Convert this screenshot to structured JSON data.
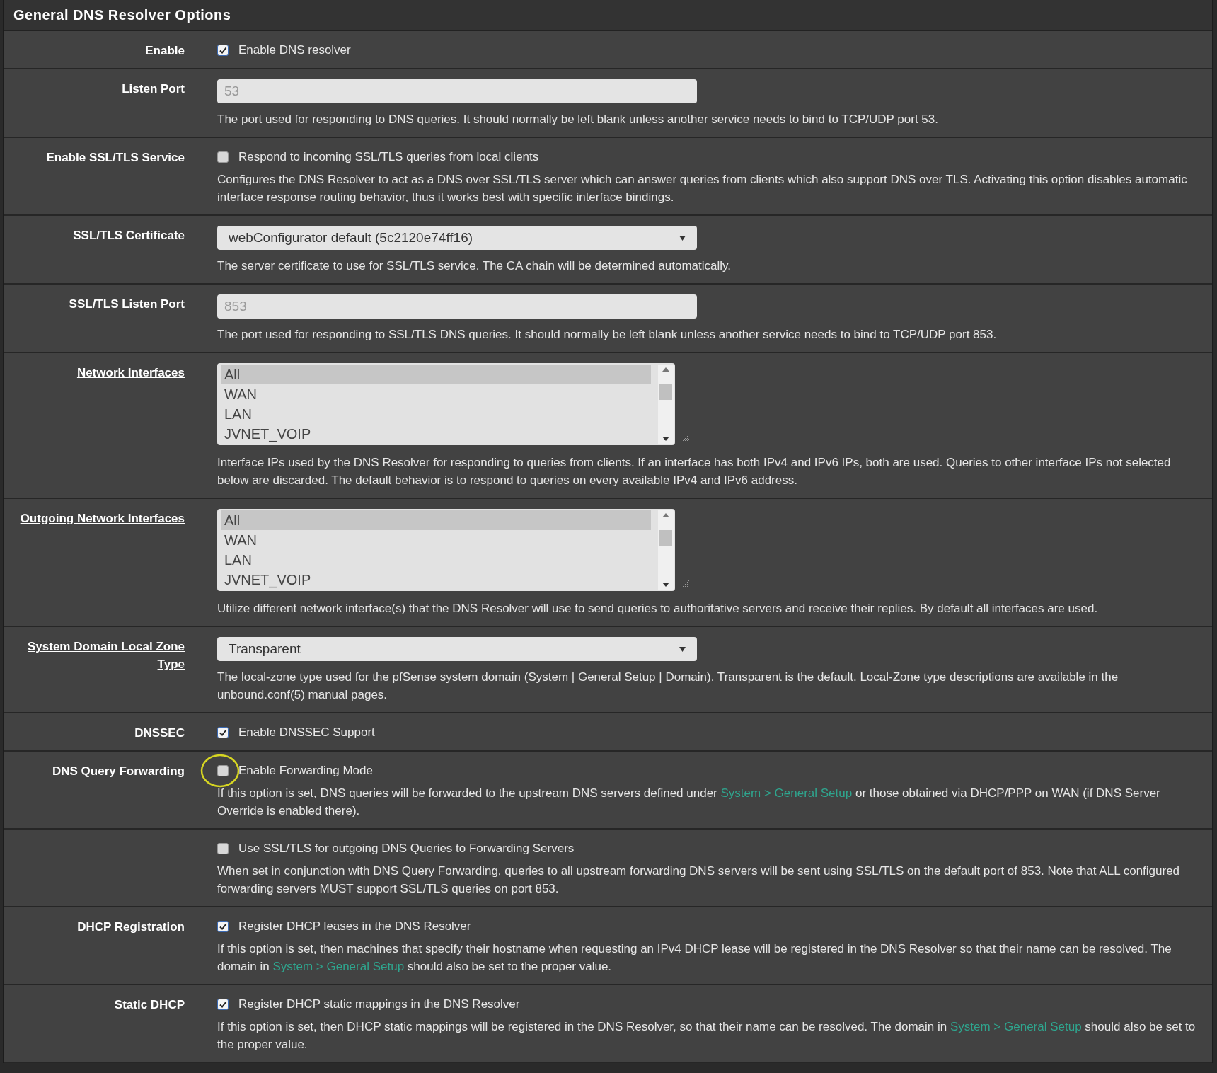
{
  "panel": {
    "title": "General DNS Resolver Options"
  },
  "rows": [
    {
      "label": "Enable",
      "label_link": false,
      "kind": "checkbox",
      "checked": true,
      "option": "Enable DNS resolver"
    },
    {
      "label": "Listen Port",
      "label_link": false,
      "kind": "input",
      "placeholder": "53",
      "description": [
        {
          "text": "The port used for responding to DNS queries. It should normally be left blank unless another service needs to bind to TCP/UDP port 53."
        }
      ]
    },
    {
      "label": "Enable SSL/TLS Service",
      "label_link": false,
      "kind": "checkbox",
      "checked": false,
      "option": "Respond to incoming SSL/TLS queries from local clients",
      "description": [
        {
          "text": "Configures the DNS Resolver to act as a DNS over SSL/TLS server which can answer queries from clients which also support DNS over TLS. Activating this option disables automatic interface response routing behavior, thus it works best with specific interface bindings."
        }
      ]
    },
    {
      "label": "SSL/TLS Certificate",
      "label_link": false,
      "kind": "select",
      "value": "webConfigurator default (5c2120e74ff16)",
      "description": [
        {
          "text": "The server certificate to use for SSL/TLS service. The CA chain will be determined automatically."
        }
      ]
    },
    {
      "label": "SSL/TLS Listen Port",
      "label_link": false,
      "kind": "input",
      "placeholder": "853",
      "description": [
        {
          "text": "The port used for responding to SSL/TLS DNS queries. It should normally be left blank unless another service needs to bind to TCP/UDP port 853."
        }
      ]
    },
    {
      "label": "Network Interfaces",
      "label_link": true,
      "kind": "listbox",
      "options": [
        {
          "label": "All",
          "selected": true
        },
        {
          "label": "WAN",
          "selected": false
        },
        {
          "label": "LAN",
          "selected": false
        },
        {
          "label": "JVNET_VOIP",
          "selected": false
        }
      ],
      "description": [
        {
          "text": "Interface IPs used by the DNS Resolver for responding to queries from clients. If an interface has both IPv4 and IPv6 IPs, both are used. Queries to other interface IPs not selected below are discarded. The default behavior is to respond to queries on every available IPv4 and IPv6 address."
        }
      ]
    },
    {
      "label": "Outgoing Network Interfaces",
      "label_link": true,
      "kind": "listbox",
      "options": [
        {
          "label": "All",
          "selected": true
        },
        {
          "label": "WAN",
          "selected": false
        },
        {
          "label": "LAN",
          "selected": false
        },
        {
          "label": "JVNET_VOIP",
          "selected": false
        }
      ],
      "description": [
        {
          "text": "Utilize different network interface(s) that the DNS Resolver will use to send queries to authoritative servers and receive their replies. By default all interfaces are used."
        }
      ]
    },
    {
      "label": "System Domain Local Zone Type",
      "label_link": true,
      "kind": "select",
      "value": "Transparent",
      "description": [
        {
          "text": "The local-zone type used for the pfSense system domain (System | General Setup | Domain). Transparent is the default. Local-Zone type descriptions are available in the unbound.conf(5) manual pages."
        }
      ]
    },
    {
      "label": "DNSSEC",
      "label_link": false,
      "kind": "checkbox",
      "checked": true,
      "option": "Enable DNSSEC Support"
    },
    {
      "label": "DNS Query Forwarding",
      "label_link": false,
      "kind": "checkbox",
      "checked": false,
      "highlighted": true,
      "option": "Enable Forwarding Mode",
      "description": [
        {
          "text": "If this option is set, DNS queries will be forwarded to the upstream DNS servers defined under "
        },
        {
          "link": "System > General Setup"
        },
        {
          "text": " or those obtained via DHCP/PPP on WAN (if DNS Server Override is enabled there)."
        }
      ]
    },
    {
      "kind": "checkbox",
      "checked": false,
      "option": "Use SSL/TLS for outgoing DNS Queries to Forwarding Servers",
      "description": [
        {
          "text": "When set in conjunction with DNS Query Forwarding, queries to all upstream forwarding DNS servers will be sent using SSL/TLS on the default port of 853. Note that ALL configured forwarding servers MUST support SSL/TLS queries on port 853."
        }
      ]
    },
    {
      "label": "DHCP Registration",
      "label_link": false,
      "kind": "checkbox",
      "checked": true,
      "option": "Register DHCP leases in the DNS Resolver",
      "description": [
        {
          "text": "If this option is set, then machines that specify their hostname when requesting an IPv4 DHCP lease will be registered in the DNS Resolver so that their name can be resolved. The domain in "
        },
        {
          "link": "System > General Setup"
        },
        {
          "text": " should also be set to the proper value."
        }
      ]
    },
    {
      "label": "Static DHCP",
      "label_link": false,
      "kind": "checkbox",
      "checked": true,
      "option": "Register DHCP static mappings in the DNS Resolver",
      "description": [
        {
          "text": "If this option is set, then DHCP static mappings will be registered in the DNS Resolver, so that their name can be resolved. The domain in "
        },
        {
          "link": "System > General Setup"
        },
        {
          "text": " should also be set to the proper value."
        }
      ]
    }
  ]
}
